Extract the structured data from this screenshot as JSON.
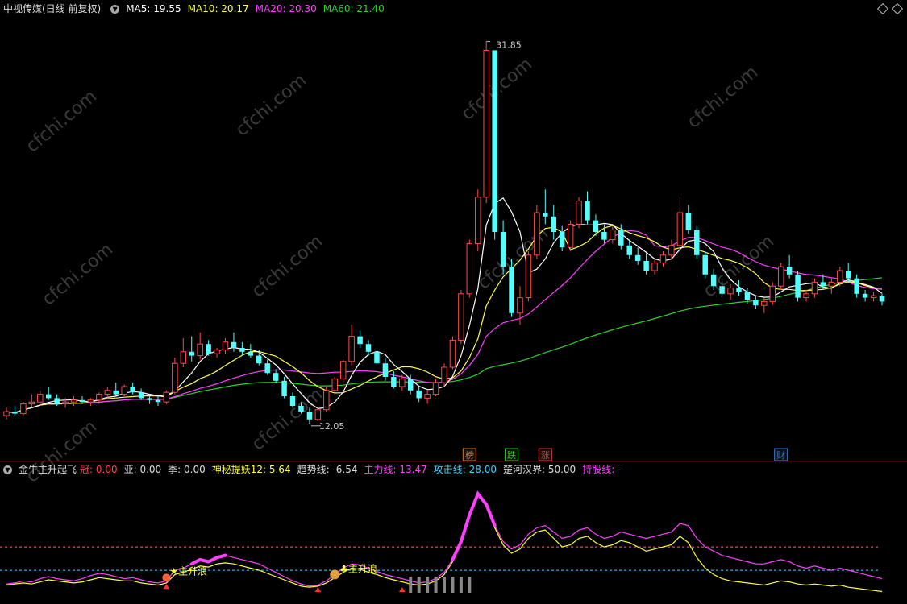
{
  "header": {
    "title": "中视传媒(日线 前复权)",
    "ma5": "MA5: 19.55",
    "ma10": "MA10: 20.17",
    "ma20": "MA20: 20.30",
    "ma60": "MA60: 21.40"
  },
  "indicator_header": {
    "name": "金牛主升起飞",
    "guan": "冠: 0.00",
    "ya": "亚: 0.00",
    "ji": "季: 0.00",
    "shenmi": "神秘提妖12: 5.64",
    "qushi": "趋势线: -6.54",
    "zhuli": "主力线: 13.47",
    "gongji": "攻击线: 28.00",
    "chuhe": "楚河汉界: 50.00",
    "chigu": "持股线: -"
  },
  "annotations": {
    "high": "31.85",
    "low": "12.05",
    "markers": [
      "榜",
      "跌",
      "涨",
      "财"
    ],
    "wave1": "主升浪",
    "wave2": "主升浪"
  },
  "colors": {
    "up": "#ff4a4a",
    "down": "#54ffff",
    "ma5": "#ffffff",
    "ma10": "#ffff4a",
    "ma20": "#ff40ff",
    "ma60": "#30d030",
    "guan": "#ff4040",
    "shenmi": "#ffff40",
    "zhuli": "#ff40ff",
    "gongji": "#40d0ff",
    "watermark": "cfchi.com"
  },
  "chart_data": [
    {
      "type": "candlestick",
      "ylim": [
        11,
        33
      ],
      "high_label": 31.85,
      "low_label": 12.05,
      "candles": [
        [
          12.5,
          12.9,
          12.3,
          12.7
        ],
        [
          12.7,
          13.0,
          12.5,
          12.6
        ],
        [
          12.6,
          13.2,
          12.5,
          13.1
        ],
        [
          13.1,
          13.6,
          12.9,
          13.2
        ],
        [
          13.2,
          13.8,
          13.0,
          13.6
        ],
        [
          13.6,
          14.0,
          13.3,
          13.4
        ],
        [
          13.4,
          13.6,
          13.0,
          13.1
        ],
        [
          13.1,
          13.4,
          12.9,
          13.2
        ],
        [
          13.2,
          13.5,
          13.0,
          13.3
        ],
        [
          13.3,
          13.5,
          13.1,
          13.2
        ],
        [
          13.2,
          13.4,
          13.0,
          13.3
        ],
        [
          13.3,
          13.7,
          13.1,
          13.6
        ],
        [
          13.6,
          14.0,
          13.4,
          13.8
        ],
        [
          13.8,
          14.2,
          13.5,
          13.6
        ],
        [
          13.6,
          14.1,
          13.5,
          14.0
        ],
        [
          14.0,
          14.2,
          13.6,
          13.7
        ],
        [
          13.7,
          13.9,
          13.3,
          13.4
        ],
        [
          13.4,
          13.6,
          13.1,
          13.3
        ],
        [
          13.3,
          13.5,
          13.0,
          13.2
        ],
        [
          13.2,
          13.8,
          13.1,
          13.7
        ],
        [
          13.7,
          15.5,
          13.6,
          15.2
        ],
        [
          15.2,
          16.5,
          15.0,
          15.8
        ],
        [
          15.8,
          16.6,
          15.3,
          15.6
        ],
        [
          15.6,
          16.8,
          15.4,
          16.2
        ],
        [
          16.2,
          16.4,
          15.6,
          15.7
        ],
        [
          15.7,
          16.0,
          15.5,
          15.9
        ],
        [
          15.9,
          16.5,
          15.7,
          16.3
        ],
        [
          16.3,
          16.8,
          15.8,
          16.0
        ],
        [
          16.0,
          16.3,
          15.6,
          15.8
        ],
        [
          15.8,
          16.2,
          15.5,
          15.6
        ],
        [
          15.6,
          15.9,
          15.1,
          15.2
        ],
        [
          15.2,
          15.4,
          14.6,
          14.7
        ],
        [
          14.7,
          14.9,
          14.2,
          14.3
        ],
        [
          14.3,
          14.5,
          13.4,
          13.5
        ],
        [
          13.5,
          13.7,
          12.9,
          13.0
        ],
        [
          13.0,
          13.2,
          12.6,
          12.7
        ],
        [
          12.7,
          12.9,
          12.05,
          12.3
        ],
        [
          12.3,
          12.9,
          12.2,
          12.8
        ],
        [
          12.8,
          14.0,
          12.7,
          13.8
        ],
        [
          13.8,
          14.5,
          13.6,
          14.4
        ],
        [
          14.4,
          15.4,
          14.2,
          15.3
        ],
        [
          15.3,
          17.2,
          15.1,
          16.6
        ],
        [
          16.6,
          16.9,
          16.0,
          16.2
        ],
        [
          16.2,
          16.4,
          15.6,
          15.8
        ],
        [
          15.8,
          16.0,
          15.0,
          15.2
        ],
        [
          15.2,
          15.5,
          14.3,
          14.5
        ],
        [
          14.5,
          14.8,
          13.9,
          14.0
        ],
        [
          14.0,
          14.6,
          13.8,
          14.4
        ],
        [
          14.4,
          14.6,
          13.6,
          13.8
        ],
        [
          13.8,
          14.0,
          13.2,
          13.4
        ],
        [
          13.4,
          13.8,
          13.1,
          13.6
        ],
        [
          13.6,
          14.4,
          13.5,
          14.2
        ],
        [
          14.2,
          15.2,
          14.0,
          15.0
        ],
        [
          15.0,
          16.6,
          14.9,
          16.4
        ],
        [
          16.4,
          19.0,
          16.2,
          18.8
        ],
        [
          18.8,
          21.6,
          18.6,
          21.4
        ],
        [
          21.4,
          24.2,
          21.0,
          23.8
        ],
        [
          23.8,
          31.85,
          23.5,
          31.4
        ],
        [
          31.4,
          30.8,
          21.6,
          22.0
        ],
        [
          22.0,
          22.6,
          19.8,
          20.2
        ],
        [
          20.2,
          20.6,
          17.6,
          17.8
        ],
        [
          17.8,
          19.2,
          17.2,
          18.6
        ],
        [
          18.6,
          21.0,
          18.4,
          20.8
        ],
        [
          20.8,
          23.4,
          20.6,
          23.0
        ],
        [
          23.0,
          24.2,
          22.4,
          22.8
        ],
        [
          22.8,
          23.4,
          21.6,
          22.0
        ],
        [
          22.0,
          22.3,
          21.0,
          21.2
        ],
        [
          21.2,
          22.6,
          21.0,
          22.4
        ],
        [
          22.4,
          23.8,
          22.2,
          23.6
        ],
        [
          23.6,
          24.1,
          22.4,
          22.6
        ],
        [
          22.6,
          22.9,
          21.8,
          22.0
        ],
        [
          22.0,
          22.4,
          21.4,
          21.6
        ],
        [
          21.6,
          22.3,
          21.4,
          22.1
        ],
        [
          22.1,
          22.4,
          21.1,
          21.3
        ],
        [
          21.3,
          21.6,
          20.6,
          20.8
        ],
        [
          20.8,
          21.2,
          20.3,
          20.5
        ],
        [
          20.5,
          20.9,
          19.8,
          20.0
        ],
        [
          20.0,
          20.6,
          19.8,
          20.4
        ],
        [
          20.4,
          21.0,
          20.2,
          20.8
        ],
        [
          20.8,
          21.6,
          20.6,
          21.3
        ],
        [
          21.3,
          23.8,
          21.1,
          23.0
        ],
        [
          23.0,
          23.4,
          21.9,
          22.1
        ],
        [
          22.1,
          22.3,
          20.6,
          20.8
        ],
        [
          20.8,
          21.0,
          19.6,
          19.8
        ],
        [
          19.8,
          20.1,
          19.0,
          19.2
        ],
        [
          19.2,
          19.6,
          18.6,
          18.8
        ],
        [
          18.8,
          19.3,
          18.5,
          19.1
        ],
        [
          19.1,
          19.5,
          18.7,
          18.9
        ],
        [
          18.9,
          19.1,
          18.3,
          18.5
        ],
        [
          18.5,
          18.7,
          18.0,
          18.2
        ],
        [
          18.2,
          18.6,
          17.8,
          18.4
        ],
        [
          18.4,
          19.4,
          18.2,
          19.2
        ],
        [
          19.2,
          20.4,
          19.0,
          20.2
        ],
        [
          20.2,
          20.8,
          19.6,
          19.8
        ],
        [
          19.8,
          20.0,
          18.4,
          18.6
        ],
        [
          18.6,
          19.0,
          18.4,
          18.8
        ],
        [
          18.8,
          19.6,
          18.6,
          19.4
        ],
        [
          19.4,
          19.8,
          19.0,
          19.2
        ],
        [
          19.2,
          19.6,
          18.8,
          19.4
        ],
        [
          19.4,
          20.2,
          19.2,
          20.0
        ],
        [
          20.0,
          20.4,
          19.4,
          19.6
        ],
        [
          19.6,
          19.8,
          18.6,
          18.8
        ],
        [
          18.8,
          19.0,
          18.4,
          18.6
        ],
        [
          18.6,
          18.9,
          18.4,
          18.7
        ],
        [
          18.7,
          18.8,
          18.2,
          18.4
        ]
      ]
    },
    {
      "type": "line",
      "ylim": [
        0,
        110
      ],
      "reference_lines": [
        28.0,
        50.0
      ],
      "series": [
        {
          "name": "主力线",
          "values": [
            15,
            16,
            18,
            17,
            20,
            22,
            20,
            19,
            18,
            20,
            23,
            25,
            24,
            22,
            20,
            21,
            19,
            17,
            16,
            18,
            28,
            30,
            34,
            38,
            36,
            40,
            42,
            40,
            38,
            36,
            34,
            30,
            26,
            22,
            18,
            15,
            13,
            14,
            18,
            24,
            30,
            34,
            33,
            30,
            27,
            24,
            22,
            20,
            18,
            16,
            17,
            20,
            26,
            38,
            55,
            80,
            100,
            90,
            70,
            55,
            48,
            52,
            62,
            68,
            70,
            64,
            58,
            60,
            66,
            68,
            62,
            58,
            60,
            64,
            62,
            60,
            58,
            60,
            62,
            64,
            72,
            70,
            58,
            50,
            46,
            42,
            40,
            38,
            36,
            34,
            34,
            36,
            38,
            36,
            32,
            30,
            32,
            30,
            28,
            30,
            28,
            26,
            24,
            22,
            20
          ]
        },
        {
          "name": "神秘提妖12",
          "values": [
            14,
            15,
            16,
            15,
            17,
            19,
            18,
            17,
            16,
            17,
            19,
            21,
            20,
            19,
            18,
            18,
            16,
            15,
            14,
            16,
            24,
            26,
            29,
            32,
            31,
            34,
            35,
            34,
            32,
            30,
            28,
            25,
            22,
            19,
            16,
            13,
            12,
            13,
            16,
            21,
            26,
            30,
            29,
            26,
            24,
            21,
            19,
            17,
            15,
            14,
            15,
            18,
            24,
            36,
            54,
            80,
            100,
            88,
            68,
            52,
            44,
            48,
            58,
            64,
            66,
            58,
            50,
            52,
            58,
            60,
            54,
            50,
            52,
            56,
            54,
            50,
            46,
            48,
            50,
            52,
            60,
            54,
            40,
            30,
            24,
            20,
            18,
            17,
            16,
            15,
            14,
            16,
            18,
            17,
            15,
            14,
            15,
            14,
            13,
            14,
            12,
            11,
            10,
            9,
            8
          ]
        }
      ]
    }
  ]
}
